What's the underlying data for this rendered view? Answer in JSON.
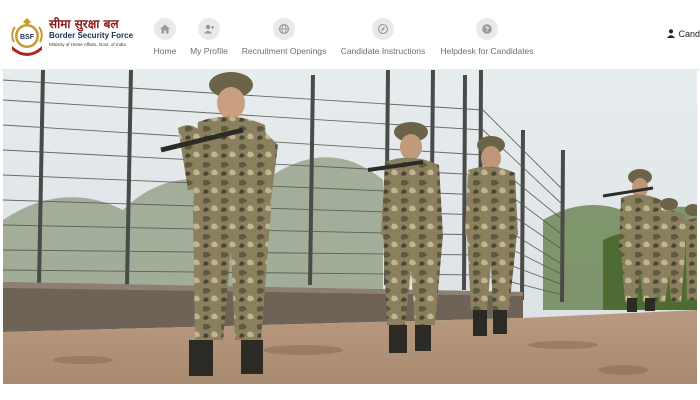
{
  "brand": {
    "name_hindi": "सीमा सुरक्षा बल",
    "name_english": "Border Security Force",
    "subtitle": "Ministry of Home Affairs, Govt. of India",
    "emblem_text": "BSF"
  },
  "nav": [
    {
      "label": "Home",
      "icon": "home-icon"
    },
    {
      "label": "My Profile",
      "icon": "user-plus-icon"
    },
    {
      "label": "Recruitment Openings",
      "icon": "globe-icon"
    },
    {
      "label": "Candidate Instructions",
      "icon": "compass-icon"
    },
    {
      "label": "Helpdesk for Candidates",
      "icon": "question-icon"
    }
  ],
  "user": {
    "label": "Cand",
    "icon": "user-icon"
  },
  "hero": {
    "description_icon": "soldiers-patrol-photo"
  },
  "colors": {
    "brand_red": "#8c1d1d",
    "brand_navy": "#1d2b55",
    "nav_text": "#6e6e6e",
    "icon_bg": "#e9e9e9"
  }
}
